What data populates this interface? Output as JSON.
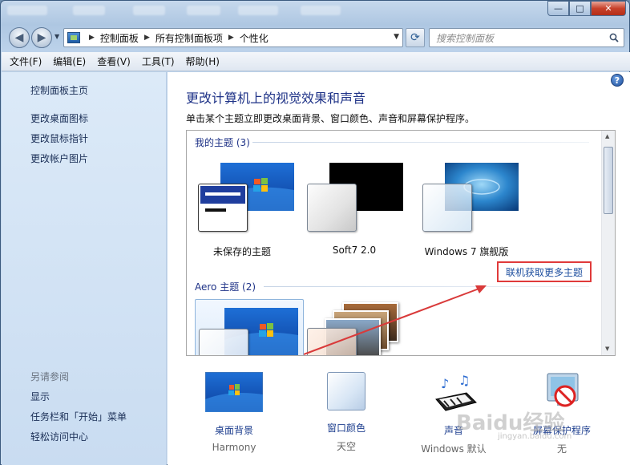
{
  "window": {
    "controls": {
      "minimize": "—",
      "maximize": "□",
      "close": "✕"
    }
  },
  "address": {
    "crumbs": [
      "控制面板",
      "所有控制面板项",
      "个性化"
    ],
    "search_placeholder": "搜索控制面板"
  },
  "menu": [
    "文件(F)",
    "编辑(E)",
    "查看(V)",
    "工具(T)",
    "帮助(H)"
  ],
  "sidebar": {
    "home": "控制面板主页",
    "links": [
      "更改桌面图标",
      "更改鼠标指针",
      "更改帐户图片"
    ],
    "see_also_heading": "另请参阅",
    "see_also": [
      "显示",
      "任务栏和「开始」菜单",
      "轻松访问中心"
    ]
  },
  "main": {
    "title": "更改计算机上的视觉效果和声音",
    "description": "单击某个主题立即更改桌面背景、窗口颜色、声音和屏幕保护程序。",
    "my_themes_label": "我的主题 (3)",
    "my_themes": [
      "未保存的主题",
      "Soft7 2.0",
      "Windows 7 旗舰版"
    ],
    "get_more_link": "联机获取更多主题",
    "aero_themes_label": "Aero 主题 (2)",
    "help_icon": "?"
  },
  "settings": [
    {
      "label": "桌面背景",
      "value": "Harmony",
      "icon": "desktop-background-icon"
    },
    {
      "label": "窗口颜色",
      "value": "天空",
      "icon": "window-color-icon"
    },
    {
      "label": "声音",
      "value": "Windows 默认",
      "icon": "sound-icon"
    },
    {
      "label": "屏幕保护程序",
      "value": "无",
      "icon": "screensaver-icon"
    }
  ],
  "watermark": {
    "main": "Baidu经验",
    "sub": "jingyan.baidu.com"
  },
  "colors": {
    "accent_link": "#1e3287",
    "highlight_box": "#e03a3a",
    "arrow": "#d93a3a"
  }
}
